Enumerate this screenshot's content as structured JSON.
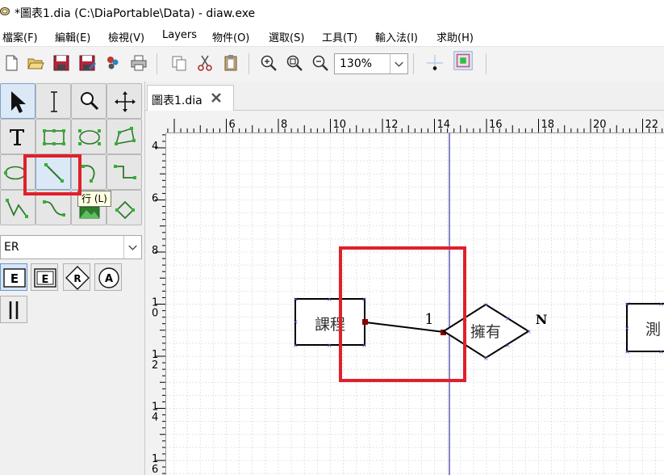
{
  "window": {
    "title": "*圖表1.dia (C:\\DiaPortable\\Data) - diaw.exe"
  },
  "menu": {
    "items": [
      {
        "label": "檔案(F)"
      },
      {
        "label": "編輯(E)"
      },
      {
        "label": "檢視(V)"
      },
      {
        "label": "Layers"
      },
      {
        "label": "物件(O)"
      },
      {
        "label": "選取(S)"
      },
      {
        "label": "工具(T)"
      },
      {
        "label": "輸入法(I)"
      },
      {
        "label": "求助(H)"
      }
    ]
  },
  "toolbar": {
    "icons": [
      "new-file-icon",
      "open-folder-icon",
      "save-icon",
      "save-as-icon",
      "export-icon",
      "print-icon",
      "copy-icon",
      "cut-icon",
      "paste-icon",
      "zoom-in-icon",
      "zoom-fit-icon",
      "zoom-out-icon",
      "snap-to-grid-icon",
      "snap-to-objects-icon"
    ],
    "zoom_value": "130%"
  },
  "toolbox": {
    "tools": [
      "pointer",
      "text-edit",
      "magnify",
      "scroll",
      "text",
      "box",
      "ellipse",
      "polygon",
      "beziergon",
      "line",
      "arc",
      "zigzagline",
      "polyline",
      "bezierline",
      "image",
      "outline"
    ],
    "tooltip": "行 (L)",
    "sheet": "ER",
    "shapes": [
      "entity",
      "weak-entity",
      "relationship",
      "attribute",
      "participation"
    ],
    "shape_glyphs": {
      "entity": "E",
      "weak_entity": "E",
      "relationship": "R",
      "attribute": "A"
    }
  },
  "tabs": [
    {
      "label": "圖表1.dia"
    }
  ],
  "rulers": {
    "horizontal": [
      "6",
      "8",
      "10",
      "12",
      "14",
      "16",
      "18",
      "20",
      "22"
    ],
    "vertical": [
      "4",
      "6",
      "8",
      "10",
      "12",
      "14",
      "16"
    ]
  },
  "diagram": {
    "entity_course": "課程",
    "relationship_has": "擁有",
    "entity_test": "測",
    "cardinality_left": "1",
    "cardinality_right": "N"
  },
  "colors": {
    "highlight": "#e0202a",
    "guide_line": "#3535a0",
    "connection_point": "#8b0000",
    "handle": "#5a5ac8",
    "grid": "#d8dde6"
  }
}
